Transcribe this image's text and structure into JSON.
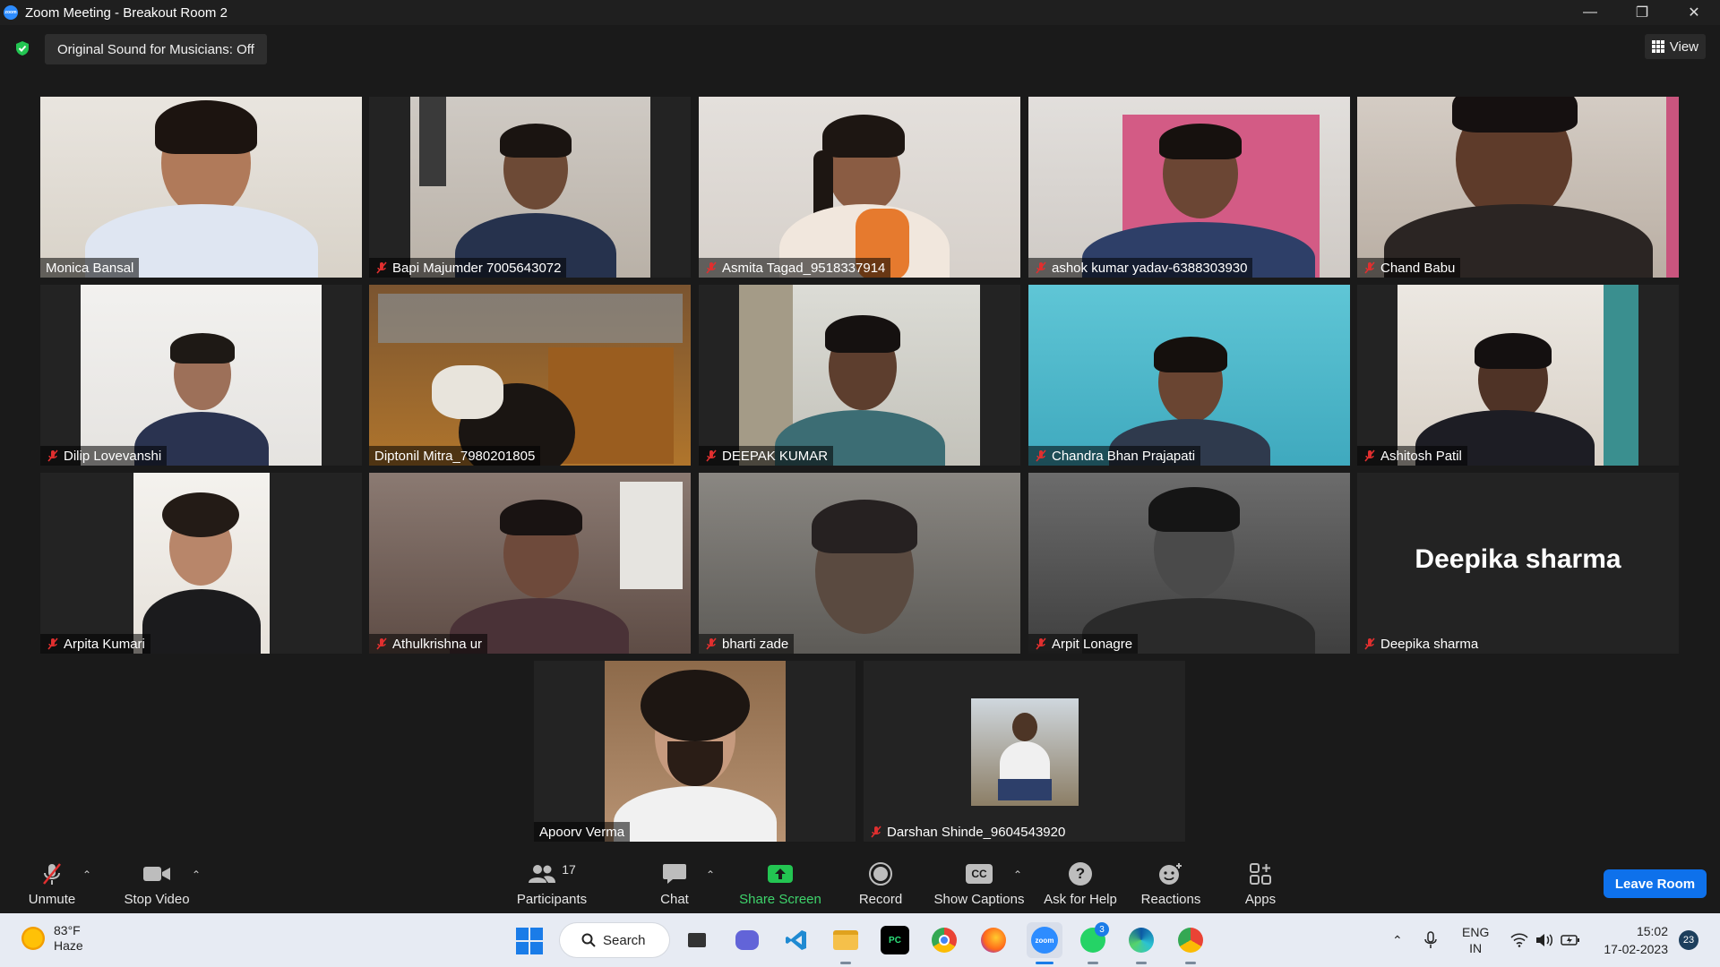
{
  "window": {
    "title": "Zoom Meeting - Breakout Room 2",
    "logo_text": "zoom"
  },
  "topbar": {
    "sound_badge": "Original Sound for Musicians: Off",
    "view_label": "View"
  },
  "participants": [
    {
      "name": "Monica Bansal",
      "muted": false
    },
    {
      "name": "Bapi Majumder 7005643072",
      "muted": true
    },
    {
      "name": "Asmita Tagad_9518337914",
      "muted": true
    },
    {
      "name": "ashok kumar yadav-6388303930",
      "muted": true
    },
    {
      "name": "Chand Babu",
      "muted": true
    },
    {
      "name": "Dilip Lovevanshi",
      "muted": true
    },
    {
      "name": "Diptonil Mitra_7980201805",
      "muted": false,
      "active_speaker": true
    },
    {
      "name": "DEEPAK KUMAR",
      "muted": true
    },
    {
      "name": "Chandra Bhan Prajapati",
      "muted": true
    },
    {
      "name": "Ashitosh Patil",
      "muted": true
    },
    {
      "name": "Arpita Kumari",
      "muted": true
    },
    {
      "name": "Athulkrishna ur",
      "muted": true
    },
    {
      "name": "bharti zade",
      "muted": true
    },
    {
      "name": "Arpit Lonagre",
      "muted": true
    },
    {
      "name": "Deepika sharma",
      "muted": true,
      "video_off": true
    },
    {
      "name": "Apoorv Verma",
      "muted": false
    },
    {
      "name": "Darshan Shinde_9604543920",
      "muted": true
    }
  ],
  "toolbar": {
    "unmute": "Unmute",
    "stop_video": "Stop Video",
    "participants": "Participants",
    "participants_count": "17",
    "chat": "Chat",
    "share_screen": "Share Screen",
    "record": "Record",
    "show_captions": "Show Captions",
    "ask_for_help": "Ask for Help",
    "reactions": "Reactions",
    "apps": "Apps",
    "leave_room": "Leave Room",
    "cc_text": "CC"
  },
  "taskbar": {
    "temperature": "83°F",
    "weather": "Haze",
    "search": "Search",
    "whatsapp_badge": "3",
    "language": "ENG",
    "region": "IN",
    "time": "15:02",
    "date": "17-02-2023",
    "notifications": "23",
    "pycharm_label": "PC",
    "zoom_label": "zoom"
  },
  "colors": {
    "accent_blue": "#0e71eb",
    "active_speaker_border": "#e3e86a",
    "share_green": "#3ed36b",
    "muted_red": "#e02f2f"
  }
}
